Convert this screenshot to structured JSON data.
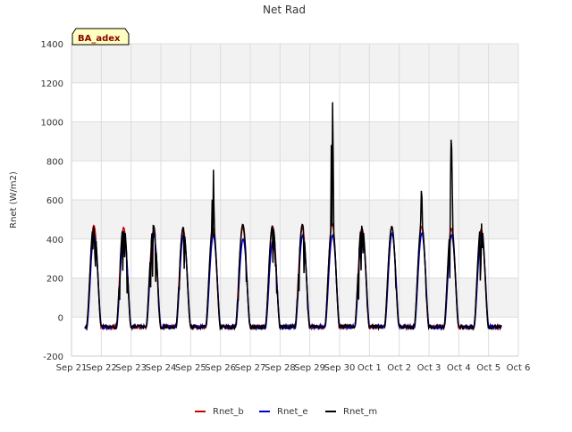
{
  "chart_data": {
    "type": "line",
    "title": "Net Rad",
    "ylabel": "Rnet (W/m2)",
    "xlabel": "",
    "site_label": "BA_adex",
    "ylim": [
      -200,
      1400
    ],
    "xlim": [
      0,
      15
    ],
    "yticks": [
      -200,
      0,
      200,
      400,
      600,
      800,
      1000,
      1200,
      1400
    ],
    "xticks": [
      "Sep 21",
      "Sep 22",
      "Sep 23",
      "Sep 24",
      "Sep 25",
      "Sep 26",
      "Sep 27",
      "Sep 28",
      "Sep 29",
      "Sep 30",
      "Oct 1",
      "Oct 2",
      "Oct 3",
      "Oct 4",
      "Oct 5",
      "Oct 6"
    ],
    "grid": true,
    "legend_position": "bottom",
    "series": [
      {
        "name": "Rnet_b",
        "color": "#cc0000"
      },
      {
        "name": "Rnet_e",
        "color": "#0000cc"
      },
      {
        "name": "Rnet_m",
        "color": "#000000"
      }
    ],
    "daily_peaks": {
      "Rnet_b": [
        470,
        460,
        440,
        450,
        455,
        460,
        465,
        460,
        480,
        455,
        460,
        465,
        455,
        450
      ],
      "Rnet_e": [
        420,
        430,
        420,
        420,
        420,
        400,
        390,
        420,
        420,
        430,
        430,
        430,
        420,
        430
      ],
      "Rnet_m": [
        510,
        485,
        470,
        460,
        870,
        475,
        470,
        475,
        1265,
        515,
        465,
        710,
        995,
        555
      ]
    },
    "night_value": -50
  }
}
